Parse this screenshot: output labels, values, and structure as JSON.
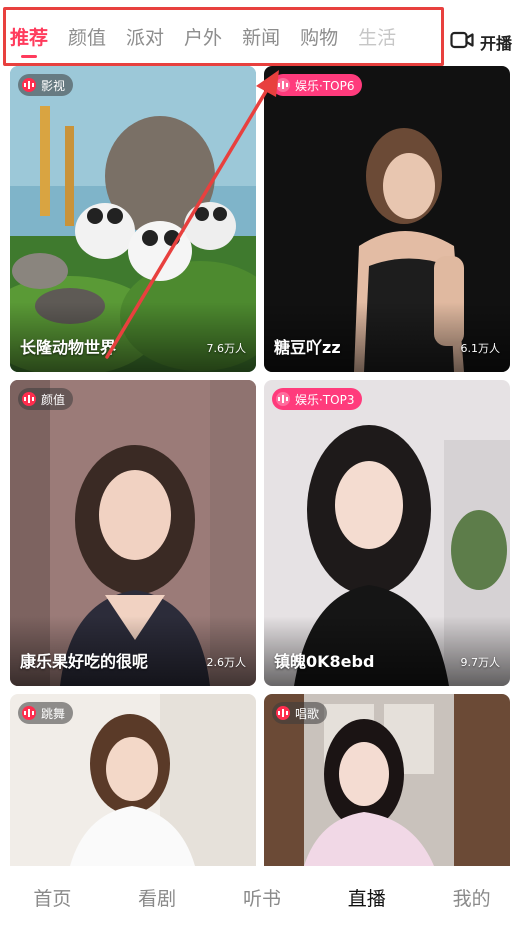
{
  "tabs": [
    {
      "label": "推荐",
      "active": true
    },
    {
      "label": "颜值"
    },
    {
      "label": "派对"
    },
    {
      "label": "户外"
    },
    {
      "label": "新闻"
    },
    {
      "label": "购物"
    },
    {
      "label": "生活"
    }
  ],
  "go_live": {
    "label": "开播",
    "icon": "video-camera-icon"
  },
  "cards": [
    {
      "tag": "影视",
      "title": "长隆动物世界",
      "viewers": "7.6万人"
    },
    {
      "tag": "娱乐·TOP6",
      "title": "糖豆吖zz",
      "viewers": "6.1万人"
    },
    {
      "tag": "颜值",
      "title": "康乐果好吃的很呢",
      "viewers": "2.6万人"
    },
    {
      "tag": "娱乐·TOP3",
      "title": "镇魄0K8ebd",
      "viewers": "9.7万人"
    },
    {
      "tag": "跳舞",
      "title": "",
      "viewers": ""
    },
    {
      "tag": "唱歌",
      "title": "",
      "viewers": ""
    }
  ],
  "bottom_nav": [
    {
      "label": "首页"
    },
    {
      "label": "看剧"
    },
    {
      "label": "听书"
    },
    {
      "label": "直播",
      "active": true
    },
    {
      "label": "我的"
    }
  ],
  "colors": {
    "accent": "#ff3b5c",
    "annotation_red": "#e8403e",
    "badge_pink": "#ff3b7c"
  }
}
